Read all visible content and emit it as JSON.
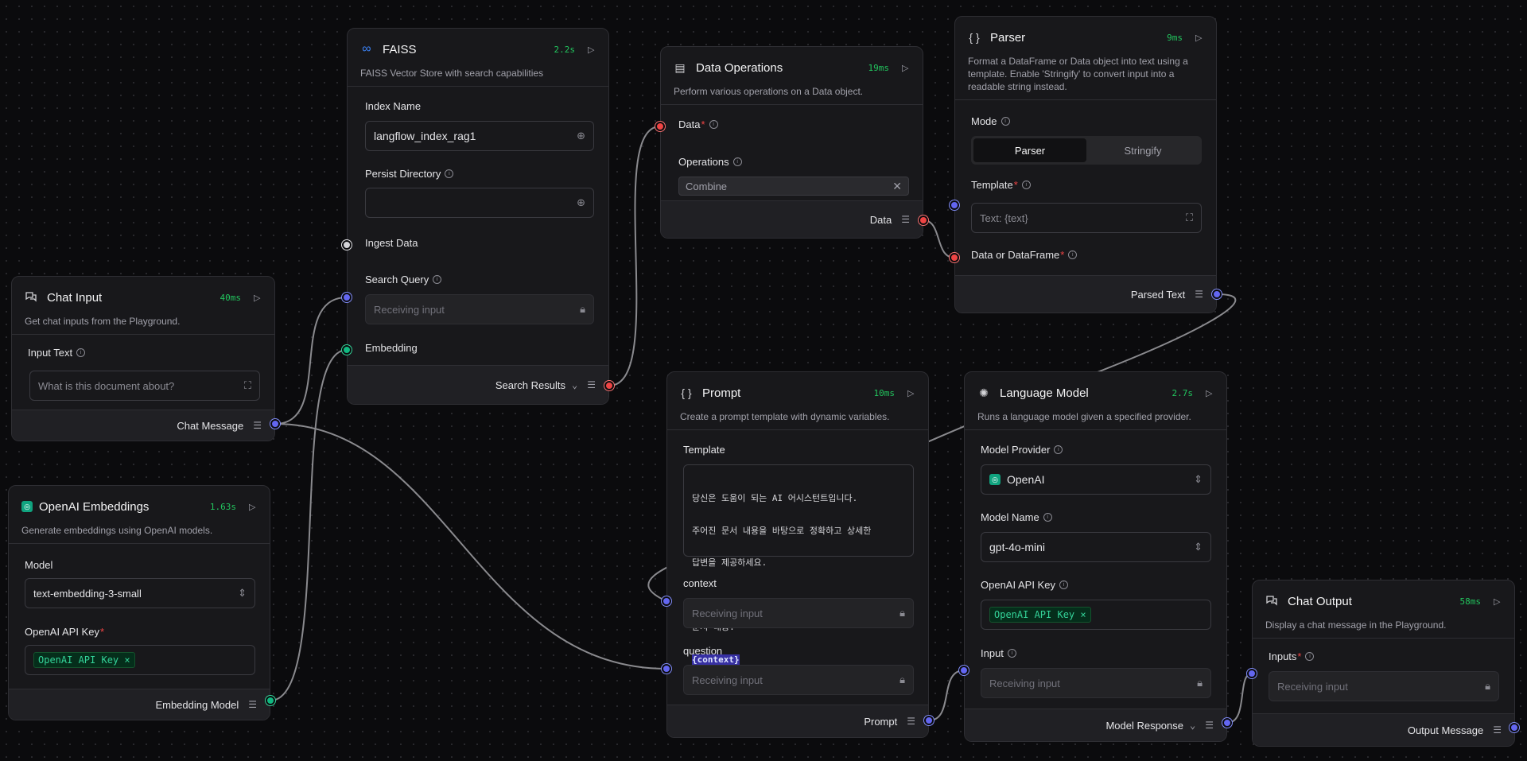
{
  "nodes": {
    "chat_input": {
      "title": "Chat Input",
      "time": "40ms",
      "description": "Get chat inputs from the Playground.",
      "input_text_label": "Input Text",
      "input_text_placeholder": "What is this document about?",
      "output_label": "Chat Message"
    },
    "openai_embeddings": {
      "title": "OpenAI Embeddings",
      "time": "1.63s",
      "description": "Generate embeddings using OpenAI models.",
      "model_label": "Model",
      "model_value": "text-embedding-3-small",
      "api_key_label": "OpenAI API Key",
      "api_key_value": "OpenAI API Key",
      "output_label": "Embedding Model"
    },
    "faiss": {
      "title": "FAISS",
      "time": "2.2s",
      "description": "FAISS Vector Store with search capabilities",
      "index_name_label": "Index Name",
      "index_name_value": "langflow_index_rag1",
      "persist_dir_label": "Persist Directory",
      "persist_dir_value": "",
      "ingest_label": "Ingest Data",
      "search_query_label": "Search Query",
      "search_query_placeholder": "Receiving input",
      "embedding_label": "Embedding",
      "output_label": "Search Results"
    },
    "data_operations": {
      "title": "Data Operations",
      "time": "19ms",
      "description": "Perform various operations on a Data object.",
      "data_label": "Data",
      "operations_label": "Operations",
      "operations_value": "Combine",
      "output_label": "Data"
    },
    "parser": {
      "title": "Parser",
      "time": "9ms",
      "description": "Format a DataFrame or Data object into text using a template. Enable 'Stringify' to convert input into a readable string instead.",
      "mode_label": "Mode",
      "mode_options": [
        "Parser",
        "Stringify"
      ],
      "mode_selected": "Parser",
      "template_label": "Template",
      "template_placeholder": "Text: {text}",
      "data_label": "Data or DataFrame",
      "output_label": "Parsed Text"
    },
    "prompt": {
      "title": "Prompt",
      "time": "10ms",
      "description": "Create a prompt template with dynamic variables.",
      "template_label": "Template",
      "template_line1": "당신은 도움이 되는 AI 어시스턴트입니다.",
      "template_line2": "주어진 문서 내용을 바탕으로 정확하고 상세한",
      "template_line3": "답변을 제공하세요.",
      "template_line4": "문서 내용:",
      "template_var": "{context}",
      "context_label": "context",
      "context_placeholder": "Receiving input",
      "question_label": "question",
      "question_placeholder": "Receiving input",
      "output_label": "Prompt"
    },
    "language_model": {
      "title": "Language Model",
      "time": "2.7s",
      "description": "Runs a language model given a specified provider.",
      "provider_label": "Model Provider",
      "provider_value": "OpenAI",
      "model_name_label": "Model Name",
      "model_name_value": "gpt-4o-mini",
      "api_key_label": "OpenAI API Key",
      "api_key_value": "OpenAI API Key",
      "input_label": "Input",
      "input_placeholder": "Receiving input",
      "output_label": "Model Response"
    },
    "chat_output": {
      "title": "Chat Output",
      "time": "58ms",
      "description": "Display a chat message in the Playground.",
      "inputs_label": "Inputs",
      "inputs_placeholder": "Receiving input",
      "output_label": "Output Message"
    }
  },
  "colors": {
    "handle_message": "#6366f1",
    "handle_data": "#ef4444",
    "handle_embedding": "#10b981",
    "handle_generic": "#d4d4d8",
    "timing": "#22c55e",
    "required": "#ef4444"
  },
  "icons": {
    "chat_input": "chat-bubbles-icon",
    "openai": "openai-logo-icon",
    "faiss": "meta-infinity-icon",
    "data_operations": "file-data-icon",
    "parser": "curly-braces-icon",
    "prompt": "curly-braces-icon",
    "language_model": "brain-circuit-icon",
    "chat_output": "chat-bubbles-icon",
    "run": "play-icon",
    "output_inspect": "list-search-icon",
    "globe": "globe-icon",
    "lock": "lock-icon",
    "expand": "expand-icon"
  }
}
